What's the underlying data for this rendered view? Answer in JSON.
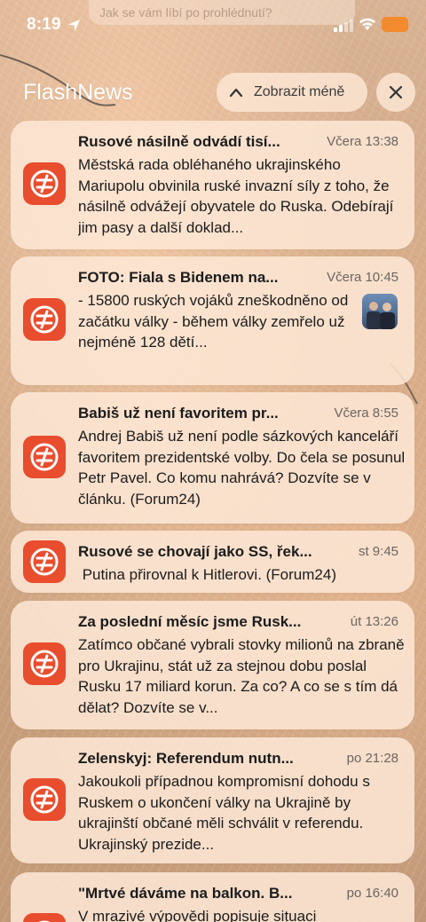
{
  "status_bar": {
    "time": "8:19",
    "faded_banner_text": "Jak se vám líbí po prohlédnutí?",
    "icons": [
      "location-arrow-icon",
      "cellular-signal-icon",
      "wifi-icon",
      "battery-icon"
    ],
    "battery_color": "#f38a2d"
  },
  "header": {
    "app_name": "FlashNews",
    "show_less_label": "Zobrazit méně",
    "close_icon": "close-icon"
  },
  "colors": {
    "app_icon_bg": "#e84d2e",
    "card_bg": "#fde8d6"
  },
  "notifications": [
    {
      "title": "Rusové násilně odvádí tisí...",
      "time": "Včera 13:38",
      "body": "Městská rada obléhaného ukrajinského Mariupolu obvinila ruské invazní síly z toho, že násilně odvážejí obyvatele do Ruska. Odebírají jim pasy a další doklad...",
      "has_thumbnail": false
    },
    {
      "title": "FOTO: Fiala s Bidenem na...",
      "time": "Včera 10:45",
      "body": "- 15800 ruských vojáků zneškodněno od začátku války - během války zemřelo už nejméně 128 dětí...",
      "has_thumbnail": true
    },
    {
      "title": "Babiš už není favoritem pr...",
      "time": "Včera 8:55",
      "body": "Andrej Babiš už není podle sázkových kanceláří favoritem prezidentské volby. Do čela se posunul Petr Pavel. Co komu nahrává? Dozvíte se v článku. (Forum24)",
      "has_thumbnail": false
    },
    {
      "title": "Rusové se chovají jako SS, řek...",
      "time": "st 9:45",
      "body": " Putina přirovnal k Hitlerovi. (Forum24)",
      "has_thumbnail": false
    },
    {
      "title": "Za poslední měsíc jsme Rusk...",
      "time": "út 13:26",
      "body": "Zatímco občané vybrali stovky milionů na zbraně pro Ukrajinu, stát už za stejnou dobu poslal Rusku 17 miliard korun. Za co? A co se s tím dá dělat? Dozvíte se v...",
      "has_thumbnail": false
    },
    {
      "title": "Zelenskyj: Referendum nutn...",
      "time": "po 21:28",
      "body": "Jakoukoli případnou kompromisní dohodu s Ruskem o ukončení války na Ukrajině by ukrajinští občané měli schválit v referendu. Ukrajinský prezide...",
      "has_thumbnail": false
    },
    {
      "title": "\"Mrtvé dáváme na balkon. B...",
      "time": "po 16:40",
      "body": "V mrazivé výpovědi popisuje situaci",
      "has_thumbnail": false
    }
  ]
}
